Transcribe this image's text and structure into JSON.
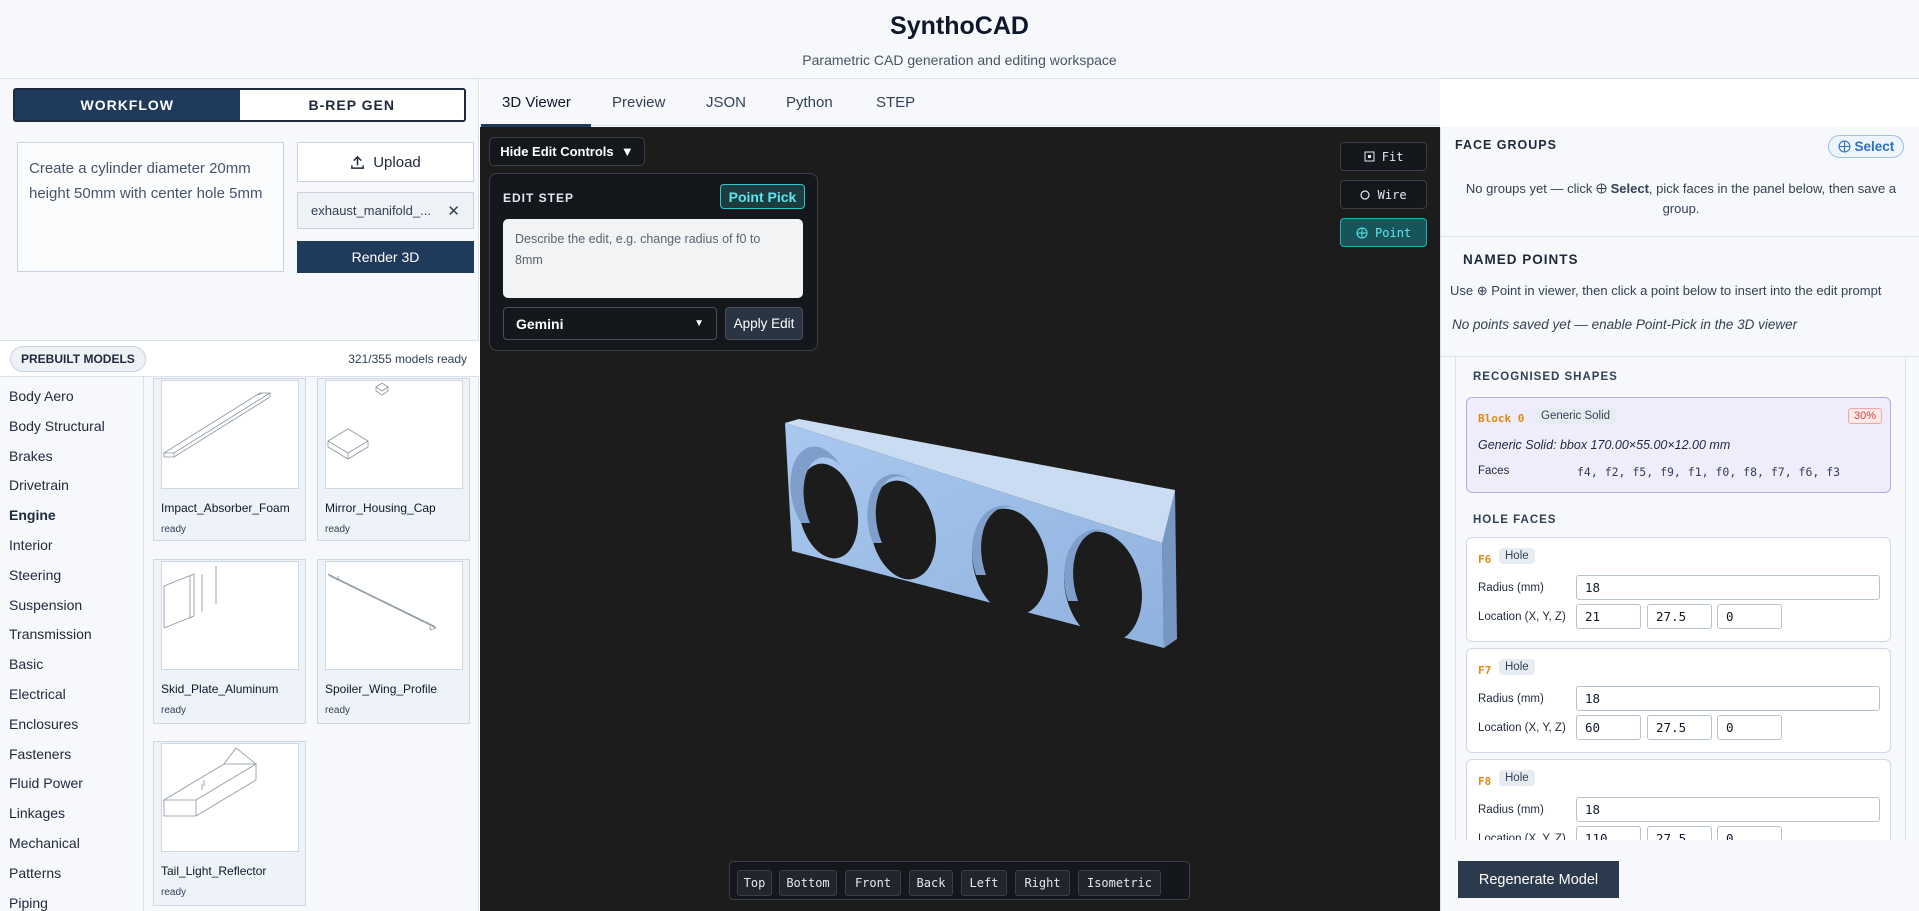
{
  "header": {
    "title": "SynthoCAD",
    "subtitle": "Parametric CAD generation and editing workspace"
  },
  "left": {
    "mode_tabs": [
      "WORKFLOW",
      "B-REP GEN"
    ],
    "prompt_text": "Create a cylinder diameter 20mm height 50mm with center hole 5mm",
    "upload_label": "Upload",
    "file_name": "exhaust_manifold_...",
    "file_remove": "✕",
    "render_label": "Render 3D",
    "prebuilt_label": "PREBUILT MODELS",
    "models_count": "321/355 models ready",
    "categories": [
      "Body Aero",
      "Body Structural",
      "Brakes",
      "Drivetrain",
      "Engine",
      "Interior",
      "Steering",
      "Suspension",
      "Transmission",
      "Basic",
      "Electrical",
      "Enclosures",
      "Fasteners",
      "Fluid Power",
      "Linkages",
      "Mechanical",
      "Patterns",
      "Piping"
    ],
    "active_category": "Engine",
    "models": [
      {
        "name": "Impact_Absorber_Foam",
        "status": "ready"
      },
      {
        "name": "Mirror_Housing_Cap",
        "status": "ready"
      },
      {
        "name": "Skid_Plate_Aluminum",
        "status": "ready"
      },
      {
        "name": "Spoiler_Wing_Profile",
        "status": "ready"
      },
      {
        "name": "Tail_Light_Reflector",
        "status": "ready"
      }
    ]
  },
  "tabs": [
    "3D Viewer",
    "Preview",
    "JSON",
    "Python",
    "STEP"
  ],
  "viewer": {
    "hide_label": "Hide Edit Controls",
    "hide_caret": "▼",
    "edit_step_label": "EDIT STEP",
    "point_pick_label": "Point Pick",
    "edit_placeholder": "Describe the edit, e.g. change radius of f0 to 8mm",
    "model_select": "Gemini",
    "apply_label": "Apply Edit",
    "fit_label": "Fit",
    "wire_label": "Wire",
    "point_label": "Point",
    "view_buttons": [
      "Top",
      "Bottom",
      "Front",
      "Back",
      "Left",
      "Right",
      "Isometric"
    ],
    "colors": {
      "background": "#1c1c1c",
      "part": "#9ebfe6",
      "accent": "#5ee5ee"
    }
  },
  "right": {
    "face_groups_title": "FACE GROUPS",
    "select_label": "Select",
    "face_groups_empty_a": "No groups yet — click ",
    "face_groups_empty_b": "Select",
    "face_groups_empty_c": ", pick faces in the panel below, then save a group.",
    "named_points_title": "NAMED POINTS",
    "named_points_help": "Use ⊕ Point in viewer, then click a point below to insert into the edit prompt",
    "named_points_empty": "No points saved yet — enable Point-Pick in the 3D viewer",
    "recognised_title": "RECOGNISED SHAPES",
    "shape": {
      "id": "Block 0",
      "type": "Generic Solid",
      "confidence": "30%",
      "desc": "Generic Solid: bbox 170.00×55.00×12.00 mm",
      "faces_label": "Faces",
      "faces": "f4, f2, f5, f9, f1, f0, f8, f7, f6, f3"
    },
    "hole_title": "HOLE FACES",
    "radius_label": "Radius (mm)",
    "location_label": "Location (X, Y, Z)",
    "holes": [
      {
        "id": "F6",
        "type": "Hole",
        "radius": "18",
        "x": "21",
        "y": "27.5",
        "z": "0"
      },
      {
        "id": "F7",
        "type": "Hole",
        "radius": "18",
        "x": "60",
        "y": "27.5",
        "z": "0"
      },
      {
        "id": "F8",
        "type": "Hole",
        "radius": "18",
        "x": "110",
        "y": "27.5",
        "z": "0"
      }
    ],
    "regenerate_label": "Regenerate Model"
  }
}
